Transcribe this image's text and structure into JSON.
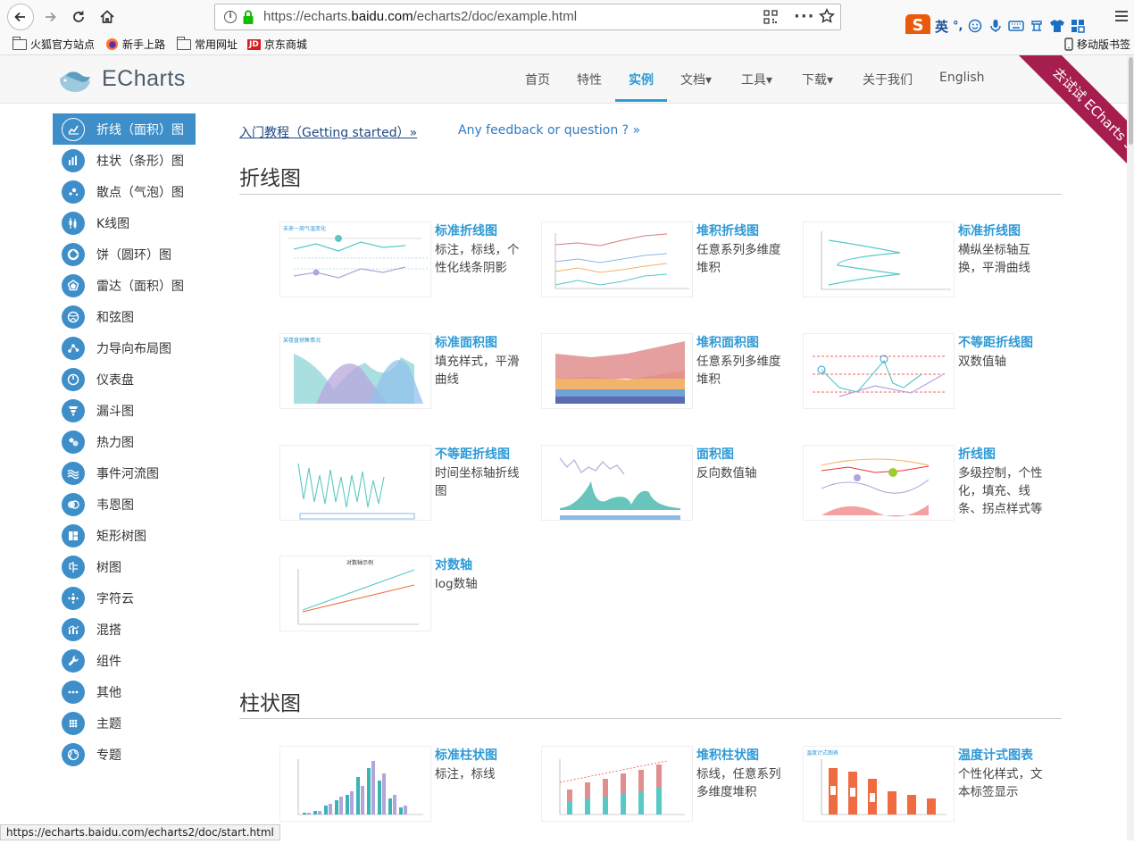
{
  "browser": {
    "url_prefix": "https://echarts.",
    "url_domain": "baidu.com",
    "url_suffix": "/echarts2/doc/example.html",
    "ime_lang": "英",
    "ime_punct": "°,",
    "ime_logo": "S",
    "bookmarks": [
      "火狐官方站点",
      "新手上路",
      "常用网址",
      "京东商城"
    ],
    "mobile_bookmarks": "移动版书签",
    "jd_badge": "JD"
  },
  "header": {
    "logo_text": "ECharts",
    "nav": [
      {
        "label": "首页"
      },
      {
        "label": "特性"
      },
      {
        "label": "实例"
      },
      {
        "label": "文档▾"
      },
      {
        "label": "工具▾"
      },
      {
        "label": "下载▾"
      },
      {
        "label": "关于我们"
      },
      {
        "label": "English"
      }
    ],
    "ribbon": "去试试 ECharts 3.0"
  },
  "sidebar": {
    "items": [
      {
        "label": "折线（面积）图",
        "icon": "line-chart-icon"
      },
      {
        "label": "柱状（条形）图",
        "icon": "bar-chart-icon"
      },
      {
        "label": "散点（气泡）图",
        "icon": "scatter-chart-icon"
      },
      {
        "label": "K线图",
        "icon": "candlestick-icon"
      },
      {
        "label": "饼（圆环）图",
        "icon": "pie-chart-icon"
      },
      {
        "label": "雷达（面积）图",
        "icon": "radar-chart-icon"
      },
      {
        "label": "和弦图",
        "icon": "chord-chart-icon"
      },
      {
        "label": "力导向布局图",
        "icon": "force-graph-icon"
      },
      {
        "label": "仪表盘",
        "icon": "gauge-icon"
      },
      {
        "label": "漏斗图",
        "icon": "funnel-icon"
      },
      {
        "label": "热力图",
        "icon": "heatmap-icon"
      },
      {
        "label": "事件河流图",
        "icon": "event-river-icon"
      },
      {
        "label": "韦恩图",
        "icon": "venn-icon"
      },
      {
        "label": "矩形树图",
        "icon": "treemap-icon"
      },
      {
        "label": "树图",
        "icon": "tree-icon"
      },
      {
        "label": "字符云",
        "icon": "word-cloud-icon"
      },
      {
        "label": "混搭",
        "icon": "mixed-chart-icon"
      },
      {
        "label": "组件",
        "icon": "wrench-icon"
      },
      {
        "label": "其他",
        "icon": "more-dots-icon"
      },
      {
        "label": "主题",
        "icon": "theme-grid-icon"
      },
      {
        "label": "专题",
        "icon": "globe-icon"
      }
    ]
  },
  "content": {
    "link_started": "入门教程（Getting started）»",
    "link_feedback": "Any feedback or question ? »",
    "sections": [
      {
        "title": "折线图",
        "cards": [
          {
            "title": "标准折线图",
            "desc": "标注，标线，个性化线条阴影"
          },
          {
            "title": "堆积折线图",
            "desc": "任意系列多维度堆积"
          },
          {
            "title": "标准折线图",
            "desc": "横纵坐标轴互换，平滑曲线"
          },
          {
            "title": "标准面积图",
            "desc": "填充样式，平滑曲线"
          },
          {
            "title": "堆积面积图",
            "desc": "任意系列多维度堆积"
          },
          {
            "title": "不等距折线图",
            "desc": "双数值轴"
          },
          {
            "title": "不等距折线图",
            "desc": "时间坐标轴折线图"
          },
          {
            "title": "面积图",
            "desc": "反向数值轴"
          },
          {
            "title": "折线图",
            "desc": "多级控制，个性化，填充、线条、拐点样式等"
          },
          {
            "title": "对数轴",
            "desc": "log数轴"
          }
        ]
      },
      {
        "title": "柱状图",
        "cards": [
          {
            "title": "标准柱状图",
            "desc": "标注，标线"
          },
          {
            "title": "堆积柱状图",
            "desc": "标线，任意系列多维度堆积"
          },
          {
            "title": "温度计式图表",
            "desc": "个性化样式，文本标签显示"
          }
        ]
      }
    ]
  },
  "status_bar": "https://echarts.baidu.com/echarts2/doc/start.html",
  "colors": {
    "accent": "#2e9ad6",
    "sidebar_active": "#3e8fc9",
    "ribbon": "#a61e4d"
  }
}
